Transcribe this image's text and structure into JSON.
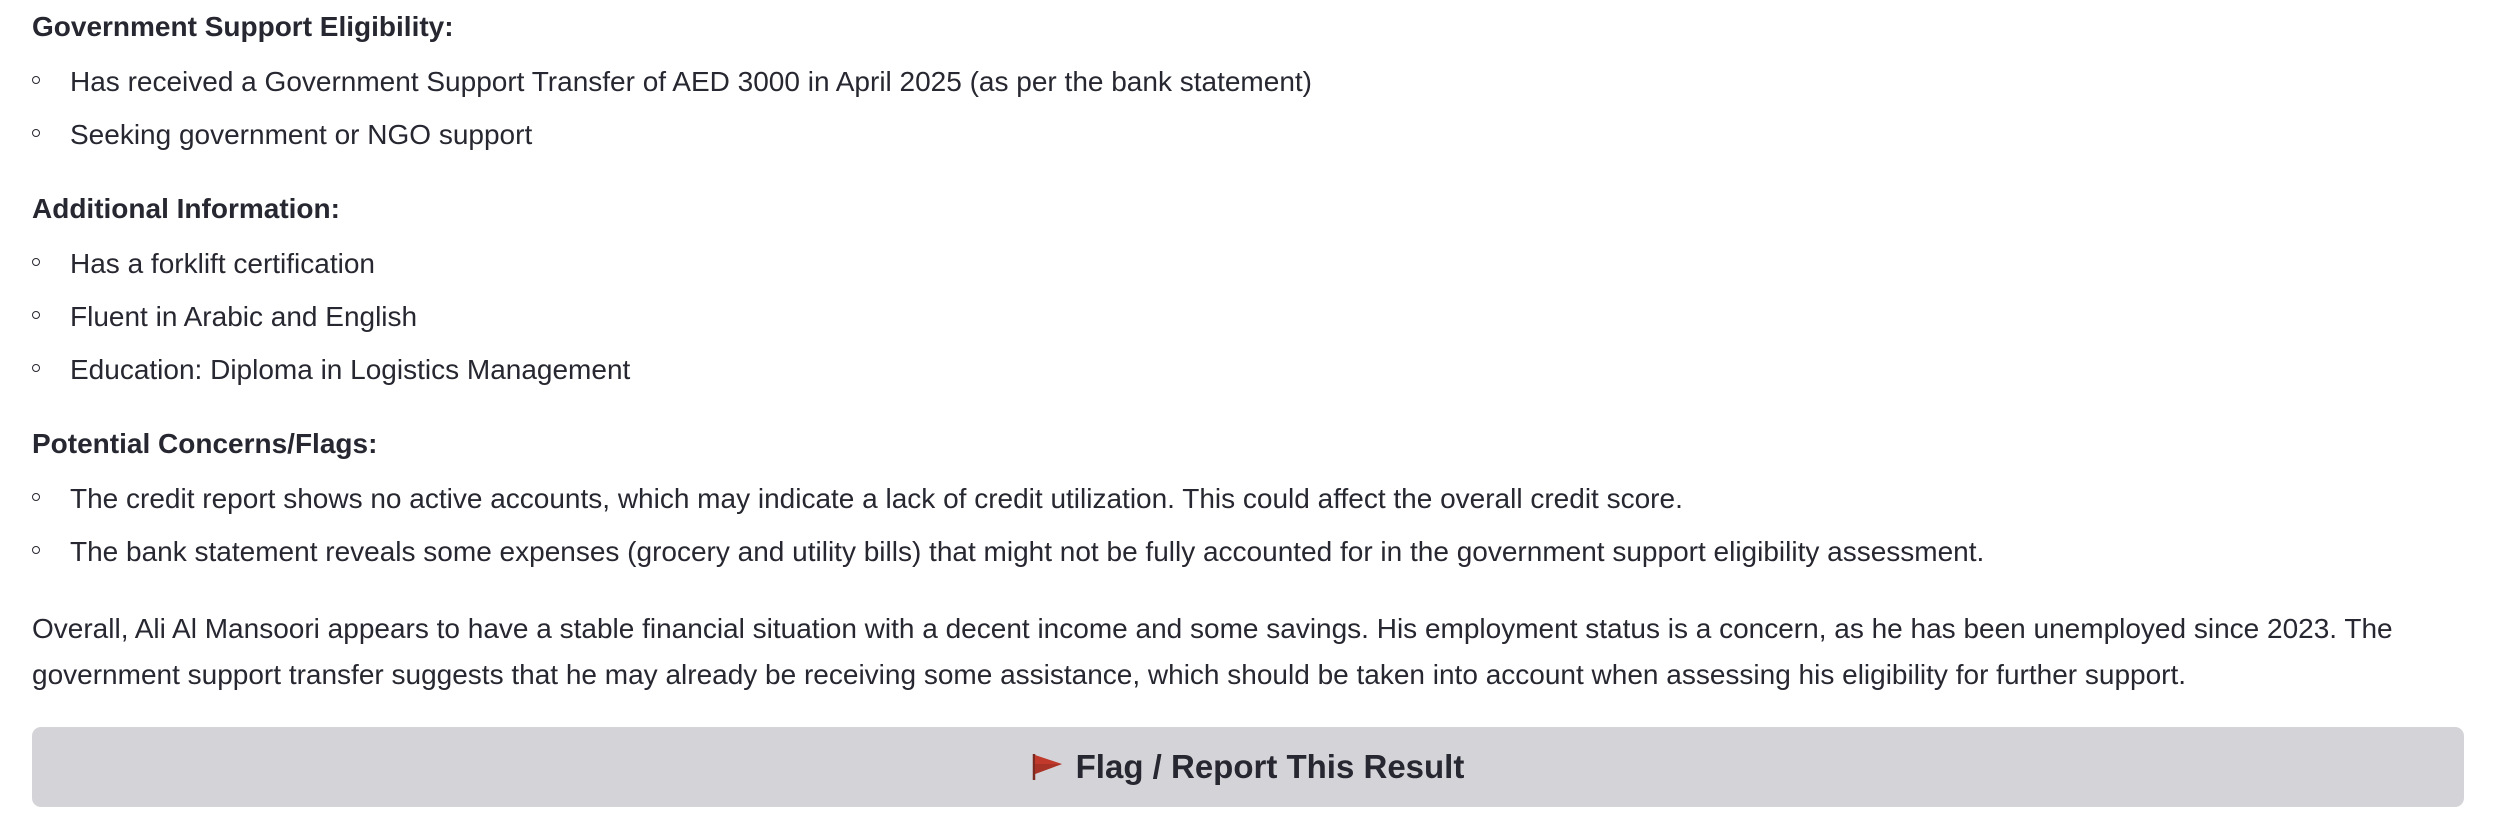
{
  "sections": {
    "government": {
      "heading": "Government Support Eligibility:",
      "items": [
        "Has received a Government Support Transfer of AED 3000 in April 2025 (as per the bank statement)",
        "Seeking government or NGO support"
      ]
    },
    "additional": {
      "heading": "Additional Information:",
      "items": [
        "Has a forklift certification",
        "Fluent in Arabic and English",
        "Education: Diploma in Logistics Management"
      ]
    },
    "concerns": {
      "heading": "Potential Concerns/Flags:",
      "items": [
        "The credit report shows no active accounts, which may indicate a lack of credit utilization. This could affect the overall credit score.",
        "The bank statement reveals some expenses (grocery and utility bills) that might not be fully accounted for in the government support eligibility assessment."
      ]
    }
  },
  "summary": "Overall, Ali Al Mansoori appears to have a stable financial situation with a decent income and some savings. His employment status is a concern, as he has been unemployed since 2023. The government support transfer suggests that he may already be receiving some assistance, which should be taken into account when assessing his eligibility for further support.",
  "flag_button": {
    "label": "Flag / Report This Result",
    "icon": "red-triangular-flag-icon"
  },
  "colors": {
    "text": "#262730",
    "button_bg": "#d4d4d8",
    "flag_red": "#c0392b"
  }
}
